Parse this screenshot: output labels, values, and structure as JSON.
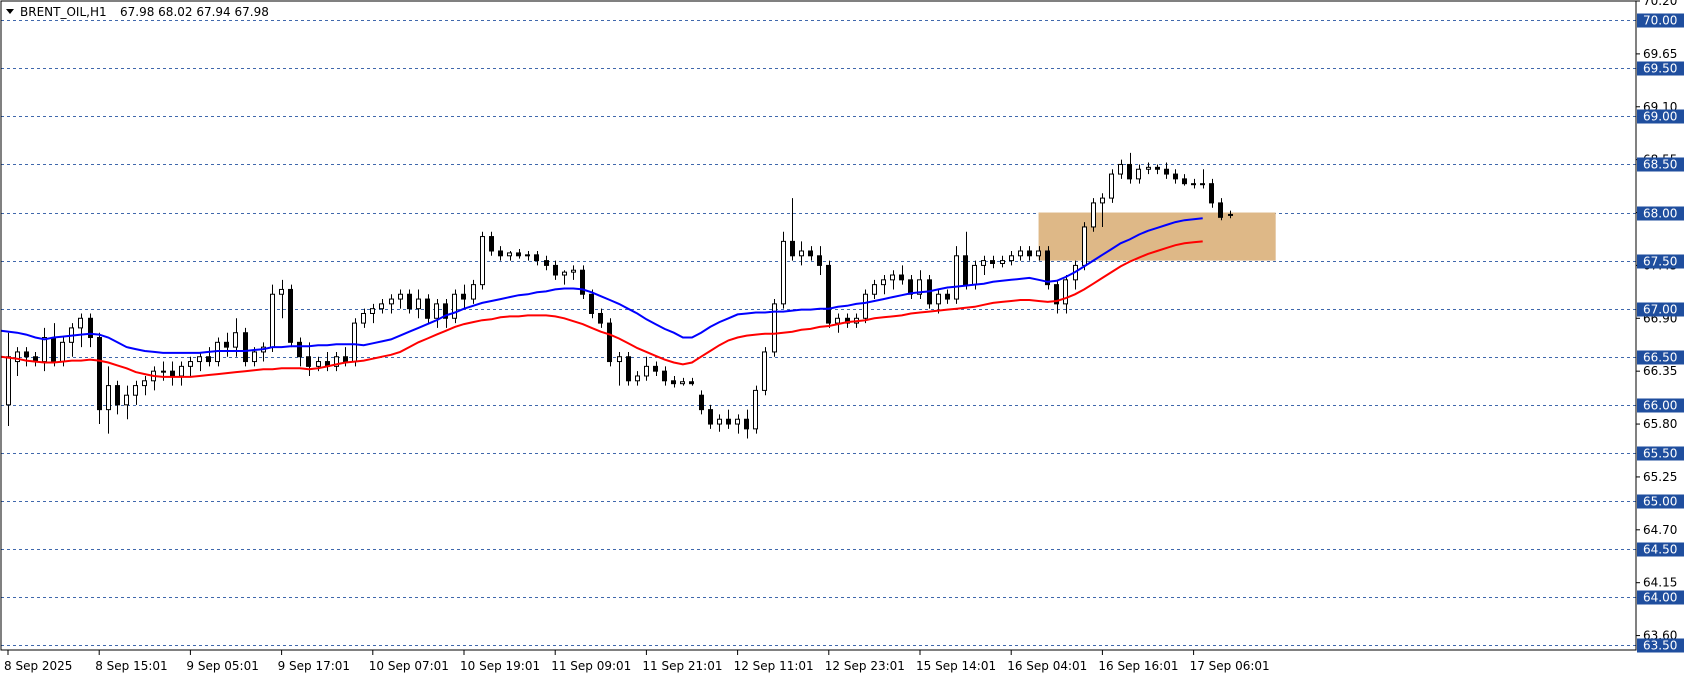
{
  "header": {
    "symbol": "BRENT_OIL,H1",
    "ohlc": "67.98 68.02 67.94 67.98"
  },
  "chart_data": {
    "type": "candlestick",
    "symbol": "BRENT_OIL",
    "timeframe": "H1",
    "ylim": [
      63.45,
      70.2
    ],
    "y_ticks": [
      "70.20",
      "69.65",
      "69.10",
      "68.55",
      "68.00",
      "67.45",
      "66.90",
      "66.35",
      "65.80",
      "65.25",
      "64.70",
      "64.15",
      "63.60"
    ],
    "level_lines": [
      "70.00",
      "69.50",
      "69.00",
      "68.50",
      "68.00",
      "67.50",
      "67.00",
      "66.50",
      "66.00",
      "65.50",
      "65.00",
      "64.50",
      "64.00",
      "63.50"
    ],
    "x_labels": [
      "8 Sep 2025",
      "8 Sep 15:01",
      "9 Sep 05:01",
      "9 Sep 17:01",
      "10 Sep 07:01",
      "10 Sep 19:01",
      "11 Sep 09:01",
      "11 Sep 21:01",
      "12 Sep 11:01",
      "12 Sep 23:01",
      "15 Sep 14:01",
      "16 Sep 04:01",
      "16 Sep 16:01",
      "17 Sep 06:01"
    ],
    "x_label_bar_index": [
      0,
      10,
      20,
      30,
      40,
      50,
      60,
      70,
      80,
      90,
      100,
      110,
      120,
      130
    ],
    "zone": {
      "bar_start": 113,
      "bar_end": 139,
      "low": 67.5,
      "high": 68.0,
      "color": "#deb887"
    },
    "colors": {
      "ma_fast": "#0000ff",
      "ma_slow": "#ff0000",
      "grid": "#1f4e9e",
      "bull": "#ffffff",
      "bear": "#000000"
    },
    "series": [
      {
        "name": "MA fast",
        "values": [
          66.77,
          66.75,
          66.73,
          66.7,
          66.68,
          66.7,
          66.71,
          66.72,
          66.73,
          66.74,
          66.73,
          66.7,
          66.65,
          66.6,
          66.58,
          66.56,
          66.55,
          66.54,
          66.54,
          66.54,
          66.54,
          66.54,
          66.55,
          66.56,
          66.56,
          66.56,
          66.56,
          66.57,
          66.58,
          66.6,
          66.6,
          66.61,
          66.61,
          66.61,
          66.62,
          66.62,
          66.63,
          66.63,
          66.63,
          66.62,
          66.64,
          66.66,
          66.68,
          66.72,
          66.76,
          66.8,
          66.84,
          66.88,
          66.93,
          66.96,
          67.0,
          67.03,
          67.06,
          67.08,
          67.1,
          67.12,
          67.14,
          67.15,
          67.17,
          67.18,
          67.2,
          67.21,
          67.21,
          67.2,
          67.17,
          67.13,
          67.09,
          67.05,
          67.0,
          66.95,
          66.89,
          66.84,
          66.79,
          66.75,
          66.7,
          66.7,
          66.75,
          66.81,
          66.86,
          66.9,
          66.94,
          66.95,
          66.96,
          66.96,
          66.97,
          66.97,
          66.98,
          66.99,
          66.99,
          67.0,
          67.0,
          67.02,
          67.03,
          67.05,
          67.06,
          67.08,
          67.1,
          67.12,
          67.14,
          67.16,
          67.17,
          67.18,
          67.2,
          67.22,
          67.23,
          67.24,
          67.25,
          67.26,
          67.28,
          67.29,
          67.3,
          67.31,
          67.32,
          67.3,
          67.28,
          67.29,
          67.33,
          67.38,
          67.44,
          67.5,
          67.56,
          67.62,
          67.68,
          67.72,
          67.77,
          67.81,
          67.84,
          67.87,
          67.9,
          67.92,
          67.93,
          67.94
        ]
      },
      {
        "name": "MA slow",
        "values": [
          66.5,
          66.48,
          66.46,
          66.45,
          66.44,
          66.44,
          66.45,
          66.46,
          66.46,
          66.47,
          66.46,
          66.44,
          66.41,
          66.38,
          66.34,
          66.32,
          66.3,
          66.29,
          66.29,
          66.29,
          66.29,
          66.3,
          66.31,
          66.32,
          66.33,
          66.34,
          66.35,
          66.36,
          66.37,
          66.37,
          66.38,
          66.38,
          66.38,
          66.37,
          66.38,
          66.4,
          66.42,
          66.44,
          66.45,
          66.46,
          66.48,
          66.5,
          66.52,
          66.55,
          66.6,
          66.65,
          66.69,
          66.73,
          66.77,
          66.81,
          66.84,
          66.86,
          66.88,
          66.89,
          66.91,
          66.92,
          66.92,
          66.93,
          66.93,
          66.93,
          66.92,
          66.9,
          66.87,
          66.84,
          66.8,
          66.76,
          66.73,
          66.69,
          66.64,
          66.59,
          66.55,
          66.51,
          66.47,
          66.44,
          66.42,
          66.44,
          66.5,
          66.56,
          66.62,
          66.67,
          66.7,
          66.72,
          66.73,
          66.74,
          66.74,
          66.75,
          66.76,
          66.78,
          66.79,
          66.81,
          66.82,
          66.84,
          66.86,
          66.87,
          66.88,
          66.9,
          66.91,
          66.92,
          66.93,
          66.95,
          66.96,
          66.97,
          66.98,
          66.99,
          67.0,
          67.01,
          67.02,
          67.04,
          67.06,
          67.07,
          67.08,
          67.09,
          67.09,
          67.08,
          67.07,
          67.08,
          67.11,
          67.15,
          67.2,
          67.26,
          67.32,
          67.38,
          67.44,
          67.49,
          67.53,
          67.57,
          67.6,
          67.63,
          67.66,
          67.68,
          67.69,
          67.7
        ]
      }
    ],
    "candles": [
      {
        "o": 66.0,
        "h": 66.75,
        "l": 65.78,
        "c": 66.5
      },
      {
        "o": 66.45,
        "h": 66.6,
        "l": 66.3,
        "c": 66.55
      },
      {
        "o": 66.55,
        "h": 66.6,
        "l": 66.4,
        "c": 66.5
      },
      {
        "o": 66.5,
        "h": 66.55,
        "l": 66.4,
        "c": 66.45
      },
      {
        "o": 66.45,
        "h": 66.8,
        "l": 66.35,
        "c": 66.7
      },
      {
        "o": 66.7,
        "h": 66.85,
        "l": 66.4,
        "c": 66.45
      },
      {
        "o": 66.45,
        "h": 66.7,
        "l": 66.4,
        "c": 66.65
      },
      {
        "o": 66.65,
        "h": 66.85,
        "l": 66.5,
        "c": 66.8
      },
      {
        "o": 66.8,
        "h": 66.95,
        "l": 66.6,
        "c": 66.9
      },
      {
        "o": 66.9,
        "h": 66.95,
        "l": 66.6,
        "c": 66.7
      },
      {
        "o": 66.7,
        "h": 66.75,
        "l": 65.8,
        "c": 65.95
      },
      {
        "o": 65.95,
        "h": 66.4,
        "l": 65.7,
        "c": 66.2
      },
      {
        "o": 66.2,
        "h": 66.25,
        "l": 65.9,
        "c": 66.0
      },
      {
        "o": 66.0,
        "h": 66.2,
        "l": 65.85,
        "c": 66.1
      },
      {
        "o": 66.1,
        "h": 66.25,
        "l": 66.0,
        "c": 66.2
      },
      {
        "o": 66.2,
        "h": 66.3,
        "l": 66.1,
        "c": 66.25
      },
      {
        "o": 66.25,
        "h": 66.4,
        "l": 66.15,
        "c": 66.35
      },
      {
        "o": 66.35,
        "h": 66.45,
        "l": 66.25,
        "c": 66.35
      },
      {
        "o": 66.35,
        "h": 66.45,
        "l": 66.2,
        "c": 66.3
      },
      {
        "o": 66.3,
        "h": 66.45,
        "l": 66.2,
        "c": 66.4
      },
      {
        "o": 66.4,
        "h": 66.5,
        "l": 66.3,
        "c": 66.45
      },
      {
        "o": 66.45,
        "h": 66.55,
        "l": 66.35,
        "c": 66.5
      },
      {
        "o": 66.5,
        "h": 66.6,
        "l": 66.4,
        "c": 66.45
      },
      {
        "o": 66.45,
        "h": 66.7,
        "l": 66.4,
        "c": 66.65
      },
      {
        "o": 66.65,
        "h": 66.75,
        "l": 66.5,
        "c": 66.6
      },
      {
        "o": 66.6,
        "h": 66.9,
        "l": 66.5,
        "c": 66.75
      },
      {
        "o": 66.75,
        "h": 66.8,
        "l": 66.4,
        "c": 66.45
      },
      {
        "o": 66.45,
        "h": 66.6,
        "l": 66.4,
        "c": 66.55
      },
      {
        "o": 66.55,
        "h": 66.65,
        "l": 66.45,
        "c": 66.6
      },
      {
        "o": 66.6,
        "h": 67.25,
        "l": 66.55,
        "c": 67.15
      },
      {
        "o": 67.15,
        "h": 67.3,
        "l": 66.9,
        "c": 67.2
      },
      {
        "o": 67.2,
        "h": 67.25,
        "l": 66.6,
        "c": 66.65
      },
      {
        "o": 66.65,
        "h": 66.7,
        "l": 66.4,
        "c": 66.5
      },
      {
        "o": 66.5,
        "h": 66.65,
        "l": 66.3,
        "c": 66.4
      },
      {
        "o": 66.4,
        "h": 66.5,
        "l": 66.35,
        "c": 66.45
      },
      {
        "o": 66.45,
        "h": 66.55,
        "l": 66.35,
        "c": 66.4
      },
      {
        "o": 66.4,
        "h": 66.55,
        "l": 66.35,
        "c": 66.5
      },
      {
        "o": 66.5,
        "h": 66.6,
        "l": 66.4,
        "c": 66.45
      },
      {
        "o": 66.45,
        "h": 66.9,
        "l": 66.4,
        "c": 66.85
      },
      {
        "o": 66.85,
        "h": 67.0,
        "l": 66.8,
        "c": 66.95
      },
      {
        "o": 66.95,
        "h": 67.05,
        "l": 66.85,
        "c": 67.0
      },
      {
        "o": 67.0,
        "h": 67.1,
        "l": 66.95,
        "c": 67.05
      },
      {
        "o": 67.05,
        "h": 67.15,
        "l": 66.95,
        "c": 67.1
      },
      {
        "o": 67.1,
        "h": 67.2,
        "l": 67.0,
        "c": 67.15
      },
      {
        "o": 67.15,
        "h": 67.2,
        "l": 66.95,
        "c": 67.0
      },
      {
        "o": 67.0,
        "h": 67.2,
        "l": 66.9,
        "c": 67.1
      },
      {
        "o": 67.1,
        "h": 67.15,
        "l": 66.85,
        "c": 66.9
      },
      {
        "o": 66.9,
        "h": 67.1,
        "l": 66.8,
        "c": 67.05
      },
      {
        "o": 67.05,
        "h": 67.1,
        "l": 66.8,
        "c": 66.9
      },
      {
        "o": 66.9,
        "h": 67.2,
        "l": 66.85,
        "c": 67.15
      },
      {
        "o": 67.15,
        "h": 67.25,
        "l": 67.0,
        "c": 67.1
      },
      {
        "o": 67.1,
        "h": 67.3,
        "l": 67.05,
        "c": 67.25
      },
      {
        "o": 67.25,
        "h": 67.8,
        "l": 67.2,
        "c": 67.75
      },
      {
        "o": 67.75,
        "h": 67.8,
        "l": 67.55,
        "c": 67.6
      },
      {
        "o": 67.6,
        "h": 67.65,
        "l": 67.5,
        "c": 67.55
      },
      {
        "o": 67.55,
        "h": 67.6,
        "l": 67.5,
        "c": 67.58
      },
      {
        "o": 67.58,
        "h": 67.62,
        "l": 67.52,
        "c": 67.55
      },
      {
        "o": 67.55,
        "h": 67.6,
        "l": 67.5,
        "c": 67.56
      },
      {
        "o": 67.56,
        "h": 67.6,
        "l": 67.45,
        "c": 67.5
      },
      {
        "o": 67.5,
        "h": 67.55,
        "l": 67.4,
        "c": 67.45
      },
      {
        "o": 67.45,
        "h": 67.5,
        "l": 67.3,
        "c": 67.35
      },
      {
        "o": 67.35,
        "h": 67.4,
        "l": 67.25,
        "c": 67.38
      },
      {
        "o": 67.38,
        "h": 67.45,
        "l": 67.3,
        "c": 67.4
      },
      {
        "o": 67.4,
        "h": 67.45,
        "l": 67.1,
        "c": 67.15
      },
      {
        "o": 67.15,
        "h": 67.2,
        "l": 66.9,
        "c": 66.95
      },
      {
        "o": 66.95,
        "h": 67.0,
        "l": 66.8,
        "c": 66.85
      },
      {
        "o": 66.85,
        "h": 66.9,
        "l": 66.4,
        "c": 66.45
      },
      {
        "o": 66.45,
        "h": 66.55,
        "l": 66.2,
        "c": 66.5
      },
      {
        "o": 66.5,
        "h": 66.55,
        "l": 66.2,
        "c": 66.25
      },
      {
        "o": 66.25,
        "h": 66.35,
        "l": 66.2,
        "c": 66.3
      },
      {
        "o": 66.3,
        "h": 66.5,
        "l": 66.25,
        "c": 66.4
      },
      {
        "o": 66.4,
        "h": 66.45,
        "l": 66.3,
        "c": 66.35
      },
      {
        "o": 66.35,
        "h": 66.4,
        "l": 66.2,
        "c": 66.25
      },
      {
        "o": 66.25,
        "h": 66.3,
        "l": 66.18,
        "c": 66.22
      },
      {
        "o": 66.22,
        "h": 66.28,
        "l": 66.2,
        "c": 66.24
      },
      {
        "o": 66.24,
        "h": 66.28,
        "l": 66.2,
        "c": 66.22
      },
      {
        "o": 66.1,
        "h": 66.15,
        "l": 65.9,
        "c": 65.95
      },
      {
        "o": 65.95,
        "h": 66.0,
        "l": 65.75,
        "c": 65.8
      },
      {
        "o": 65.8,
        "h": 65.9,
        "l": 65.72,
        "c": 65.85
      },
      {
        "o": 65.85,
        "h": 65.95,
        "l": 65.75,
        "c": 65.8
      },
      {
        "o": 65.8,
        "h": 65.9,
        "l": 65.7,
        "c": 65.85
      },
      {
        "o": 65.85,
        "h": 65.95,
        "l": 65.65,
        "c": 65.75
      },
      {
        "o": 65.75,
        "h": 66.2,
        "l": 65.7,
        "c": 66.15
      },
      {
        "o": 66.15,
        "h": 66.6,
        "l": 66.1,
        "c": 66.55
      },
      {
        "o": 66.55,
        "h": 67.1,
        "l": 66.5,
        "c": 67.05
      },
      {
        "o": 67.05,
        "h": 67.8,
        "l": 67.0,
        "c": 67.7
      },
      {
        "o": 67.7,
        "h": 68.15,
        "l": 67.5,
        "c": 67.55
      },
      {
        "o": 67.55,
        "h": 67.7,
        "l": 67.45,
        "c": 67.6
      },
      {
        "o": 67.6,
        "h": 67.65,
        "l": 67.5,
        "c": 67.55
      },
      {
        "o": 67.55,
        "h": 67.65,
        "l": 67.35,
        "c": 67.45
      },
      {
        "o": 67.45,
        "h": 67.5,
        "l": 66.8,
        "c": 66.85
      },
      {
        "o": 66.85,
        "h": 66.95,
        "l": 66.75,
        "c": 66.9
      },
      {
        "o": 66.9,
        "h": 66.95,
        "l": 66.8,
        "c": 66.85
      },
      {
        "o": 66.85,
        "h": 66.95,
        "l": 66.8,
        "c": 66.9
      },
      {
        "o": 66.9,
        "h": 67.2,
        "l": 66.85,
        "c": 67.15
      },
      {
        "o": 67.15,
        "h": 67.3,
        "l": 67.1,
        "c": 67.25
      },
      {
        "o": 67.25,
        "h": 67.35,
        "l": 67.15,
        "c": 67.3
      },
      {
        "o": 67.3,
        "h": 67.4,
        "l": 67.2,
        "c": 67.35
      },
      {
        "o": 67.35,
        "h": 67.45,
        "l": 67.25,
        "c": 67.3
      },
      {
        "o": 67.3,
        "h": 67.35,
        "l": 67.1,
        "c": 67.15
      },
      {
        "o": 67.15,
        "h": 67.4,
        "l": 67.1,
        "c": 67.3
      },
      {
        "o": 67.3,
        "h": 67.35,
        "l": 67.0,
        "c": 67.05
      },
      {
        "o": 67.05,
        "h": 67.2,
        "l": 66.95,
        "c": 67.15
      },
      {
        "o": 67.15,
        "h": 67.2,
        "l": 67.05,
        "c": 67.1
      },
      {
        "o": 67.1,
        "h": 67.65,
        "l": 67.05,
        "c": 67.55
      },
      {
        "o": 67.55,
        "h": 67.8,
        "l": 67.2,
        "c": 67.25
      },
      {
        "o": 67.25,
        "h": 67.5,
        "l": 67.2,
        "c": 67.45
      },
      {
        "o": 67.45,
        "h": 67.55,
        "l": 67.35,
        "c": 67.5
      },
      {
        "o": 67.5,
        "h": 67.55,
        "l": 67.42,
        "c": 67.47
      },
      {
        "o": 67.47,
        "h": 67.55,
        "l": 67.43,
        "c": 67.5
      },
      {
        "o": 67.5,
        "h": 67.6,
        "l": 67.45,
        "c": 67.55
      },
      {
        "o": 67.55,
        "h": 67.65,
        "l": 67.5,
        "c": 67.6
      },
      {
        "o": 67.6,
        "h": 67.65,
        "l": 67.5,
        "c": 67.55
      },
      {
        "o": 67.55,
        "h": 67.65,
        "l": 67.5,
        "c": 67.6
      },
      {
        "o": 67.6,
        "h": 67.65,
        "l": 67.2,
        "c": 67.25
      },
      {
        "o": 67.25,
        "h": 67.3,
        "l": 66.95,
        "c": 67.05
      },
      {
        "o": 67.05,
        "h": 67.35,
        "l": 66.95,
        "c": 67.3
      },
      {
        "o": 67.3,
        "h": 67.5,
        "l": 67.2,
        "c": 67.45
      },
      {
        "o": 67.45,
        "h": 67.9,
        "l": 67.4,
        "c": 67.85
      },
      {
        "o": 67.85,
        "h": 68.15,
        "l": 67.8,
        "c": 68.1
      },
      {
        "o": 68.1,
        "h": 68.2,
        "l": 67.85,
        "c": 68.15
      },
      {
        "o": 68.15,
        "h": 68.45,
        "l": 68.1,
        "c": 68.4
      },
      {
        "o": 68.4,
        "h": 68.55,
        "l": 68.35,
        "c": 68.5
      },
      {
        "o": 68.5,
        "h": 68.62,
        "l": 68.3,
        "c": 68.35
      },
      {
        "o": 68.35,
        "h": 68.5,
        "l": 68.3,
        "c": 68.45
      },
      {
        "o": 68.45,
        "h": 68.52,
        "l": 68.4,
        "c": 68.47
      },
      {
        "o": 68.47,
        "h": 68.5,
        "l": 68.4,
        "c": 68.45
      },
      {
        "o": 68.45,
        "h": 68.52,
        "l": 68.35,
        "c": 68.4
      },
      {
        "o": 68.4,
        "h": 68.45,
        "l": 68.3,
        "c": 68.35
      },
      {
        "o": 68.35,
        "h": 68.4,
        "l": 68.28,
        "c": 68.3
      },
      {
        "o": 68.3,
        "h": 68.35,
        "l": 68.25,
        "c": 68.3
      },
      {
        "o": 68.3,
        "h": 68.45,
        "l": 68.25,
        "c": 68.3
      },
      {
        "o": 68.3,
        "h": 68.35,
        "l": 68.05,
        "c": 68.1
      },
      {
        "o": 68.1,
        "h": 68.15,
        "l": 67.92,
        "c": 67.95
      },
      {
        "o": 67.98,
        "h": 68.02,
        "l": 67.94,
        "c": 67.98
      }
    ]
  }
}
